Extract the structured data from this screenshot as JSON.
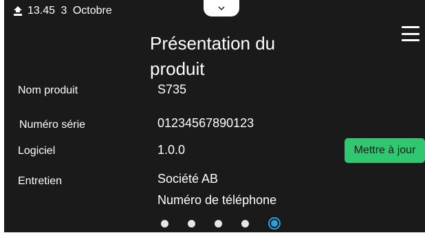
{
  "status": {
    "time": "13.45",
    "day": "3",
    "month": "Octobre",
    "icon": "home-signal-icon"
  },
  "header": {
    "title": "Présentation du produit",
    "menu_icon": "hamburger-menu-icon",
    "pull_tab_icon": "chevron-down-icon"
  },
  "info": {
    "product_name": {
      "label": "Nom produit",
      "value": "S735"
    },
    "serial_number": {
      "label": "Numéro série",
      "value": "01234567890123"
    },
    "software": {
      "label": "Logiciel",
      "value": "1.0.0"
    },
    "service": {
      "label": "Entretien",
      "value": "Société AB",
      "value2": "Numéro de téléphone"
    }
  },
  "actions": {
    "update_label": "Mettre à jour"
  },
  "pager": {
    "total": 5,
    "current": 5
  },
  "colors": {
    "background": "#1a1a1a",
    "accent_green": "#2fc76f",
    "accent_blue": "#2a9fd8",
    "text": "#ffffff"
  }
}
